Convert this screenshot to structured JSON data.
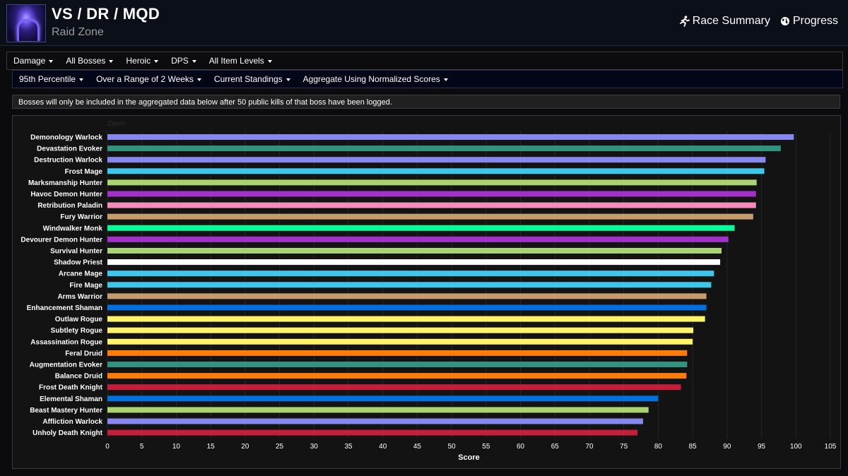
{
  "header": {
    "title": "VS / DR / MQD",
    "subtitle": "Raid Zone",
    "links": [
      {
        "label": "Race Summary",
        "icon": "runner-icon"
      },
      {
        "label": "Progress",
        "icon": "globe-icon"
      }
    ]
  },
  "filters_primary": [
    "Damage",
    "All Bosses",
    "Heroic",
    "DPS",
    "All Item Levels"
  ],
  "filters_secondary": [
    "95th Percentile",
    "Over a Range of 2 Weeks",
    "Current Standings",
    "Aggregate Using Normalized Scores"
  ],
  "notice": "Bosses will only be included in the aggregated data below after 50 public kills of that boss have been logged.",
  "chart_data": {
    "type": "bar",
    "orientation": "horizontal",
    "zoom_label": "Zoom",
    "xlabel": "Score",
    "xlim": [
      0,
      105
    ],
    "xticks": [
      0,
      5,
      10,
      15,
      20,
      25,
      30,
      35,
      40,
      45,
      50,
      55,
      60,
      65,
      70,
      75,
      80,
      85,
      90,
      95,
      100,
      105
    ],
    "grid": true,
    "categories": [
      "Demonology Warlock",
      "Devastation Evoker",
      "Destruction Warlock",
      "Frost Mage",
      "Marksmanship Hunter",
      "Havoc Demon Hunter",
      "Retribution Paladin",
      "Fury Warrior",
      "Windwalker Monk",
      "Devourer Demon Hunter",
      "Survival Hunter",
      "Shadow Priest",
      "Arcane Mage",
      "Fire Mage",
      "Arms Warrior",
      "Enhancement Shaman",
      "Outlaw Rogue",
      "Subtlety Rogue",
      "Assassination Rogue",
      "Feral Druid",
      "Augmentation Evoker",
      "Balance Druid",
      "Frost Death Knight",
      "Elemental Shaman",
      "Beast Mastery Hunter",
      "Affliction Warlock",
      "Unholy Death Knight"
    ],
    "values": [
      99.7,
      97.8,
      95.6,
      95.4,
      94.3,
      94.2,
      94.2,
      93.8,
      91.1,
      90.2,
      89.2,
      89.0,
      88.1,
      87.7,
      87.0,
      87.0,
      86.8,
      85.1,
      85.0,
      84.2,
      84.2,
      84.1,
      83.3,
      80.0,
      78.6,
      77.8,
      77.0
    ],
    "colors": [
      "#8788EE",
      "#33937F",
      "#8788EE",
      "#3FC7EB",
      "#AAD372",
      "#A330C9",
      "#F48CBA",
      "#C69B6D",
      "#00FF98",
      "#A330C9",
      "#AAD372",
      "#FFFFFF",
      "#3FC7EB",
      "#3FC7EB",
      "#C69B6D",
      "#0070DD",
      "#FFF468",
      "#FFF468",
      "#FFF468",
      "#FF7C0A",
      "#33937F",
      "#FF7C0A",
      "#C41E3A",
      "#0070DD",
      "#AAD372",
      "#8788EE",
      "#C41E3A"
    ]
  }
}
